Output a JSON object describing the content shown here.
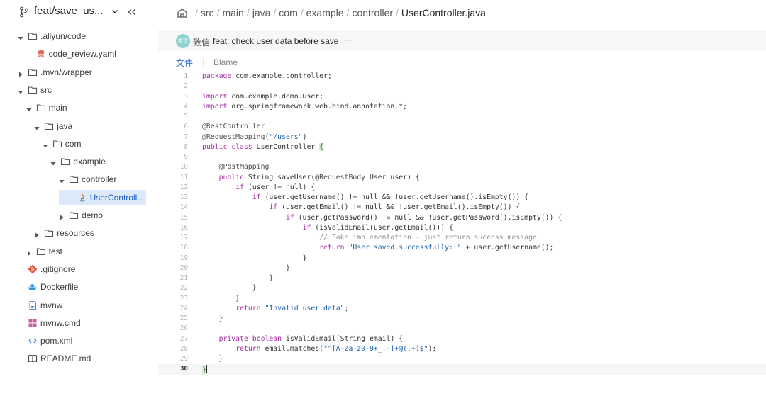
{
  "sidebar": {
    "branch": "feat/save_us...",
    "tree": [
      {
        "label": ".aliyun/code",
        "depth": 0,
        "kind": "folder",
        "open": true
      },
      {
        "label": "code_review.yaml",
        "depth": 1,
        "kind": "yaml"
      },
      {
        "label": ".mvn/wrapper",
        "depth": 0,
        "kind": "folder",
        "open": false
      },
      {
        "label": "src",
        "depth": 0,
        "kind": "folder",
        "open": true
      },
      {
        "label": "main",
        "depth": 1,
        "kind": "folder",
        "open": true
      },
      {
        "label": "java",
        "depth": 2,
        "kind": "folder",
        "open": true
      },
      {
        "label": "com",
        "depth": 3,
        "kind": "folder",
        "open": true
      },
      {
        "label": "example",
        "depth": 4,
        "kind": "folder",
        "open": true
      },
      {
        "label": "controller",
        "depth": 5,
        "kind": "folder",
        "open": true
      },
      {
        "label": "UserControll...",
        "depth": 6,
        "kind": "java",
        "selected": true
      },
      {
        "label": "demo",
        "depth": 5,
        "kind": "folder",
        "open": false
      },
      {
        "label": "resources",
        "depth": 2,
        "kind": "folder",
        "open": false
      },
      {
        "label": "test",
        "depth": 1,
        "kind": "folder",
        "open": false
      },
      {
        "label": ".gitignore",
        "depth": 0,
        "kind": "git"
      },
      {
        "label": "Dockerfile",
        "depth": 0,
        "kind": "docker"
      },
      {
        "label": "mvnw",
        "depth": 0,
        "kind": "doc"
      },
      {
        "label": "mvnw.cmd",
        "depth": 0,
        "kind": "windows"
      },
      {
        "label": "pom.xml",
        "depth": 0,
        "kind": "xml"
      },
      {
        "label": "README.md",
        "depth": 0,
        "kind": "book"
      }
    ]
  },
  "breadcrumb": {
    "segments": [
      "src",
      "main",
      "java",
      "com",
      "example",
      "controller"
    ],
    "current": "UserController.java"
  },
  "commit": {
    "avatar_text": "致信",
    "author": "致信",
    "message": "feat: check user data before save",
    "more": "···"
  },
  "tabs": [
    {
      "label": "文件",
      "active": true
    },
    {
      "label": "Blame",
      "active": false
    }
  ],
  "code": {
    "current_line": 30,
    "lines": [
      "package com.example.controller;",
      "",
      "import com.example.demo.User;",
      "import org.springframework.web.bind.annotation.*;",
      "",
      "@RestController",
      "@RequestMapping(\"/users\")",
      "public class UserController {",
      "",
      "    @PostMapping",
      "    public String saveUser(@RequestBody User user) {",
      "        if (user != null) {",
      "            if (user.getUsername() != null && !user.getUsername().isEmpty()) {",
      "                if (user.getEmail() != null && !user.getEmail().isEmpty()) {",
      "                    if (user.getPassword() != null && !user.getPassword().isEmpty()) {",
      "                        if (isValidEmail(user.getEmail())) {",
      "                            // Fake implementation - just return success message",
      "                            return \"User saved successfully: \" + user.getUsername();",
      "                        }",
      "                    }",
      "                }",
      "            }",
      "        }",
      "        return \"Invalid user data\";",
      "    }",
      "",
      "    private boolean isValidEmail(String email) {",
      "        return email.matches(\"^[A-Za-z0-9+_.-]+@(.+)$\");",
      "    }",
      "}"
    ]
  }
}
